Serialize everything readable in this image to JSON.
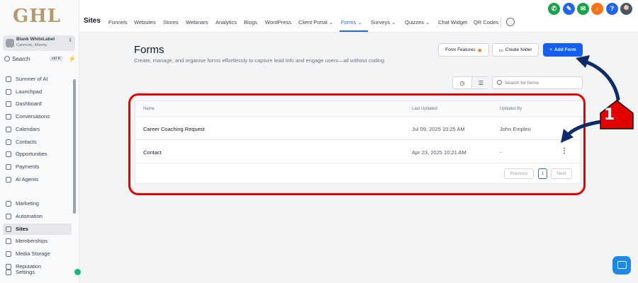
{
  "brand": {
    "logo_text": "GHL"
  },
  "account": {
    "name": "Blank WhiteLabel",
    "location": "Canmore, Alberta"
  },
  "sidebar_search": {
    "label": "Search",
    "shortcut": "ctrl K"
  },
  "sidebar": {
    "items": [
      {
        "label": "Summer of AI",
        "icon": "sparkle-icon"
      },
      {
        "label": "Launchpad",
        "icon": "rocket-icon"
      },
      {
        "label": "Dashboard",
        "icon": "grid-icon"
      },
      {
        "label": "Conversations",
        "icon": "chat-icon"
      },
      {
        "label": "Calendars",
        "icon": "calendar-icon"
      },
      {
        "label": "Contacts",
        "icon": "contacts-icon"
      },
      {
        "label": "Opportunities",
        "icon": "funnel-icon"
      },
      {
        "label": "Payments",
        "icon": "payment-icon"
      },
      {
        "label": "AI Agents",
        "icon": "sparkle-icon"
      },
      {
        "label": "Marketing",
        "icon": "send-icon"
      },
      {
        "label": "Automation",
        "icon": "automation-icon"
      },
      {
        "label": "Sites",
        "icon": "sites-icon",
        "active": true
      },
      {
        "label": "Memberships",
        "icon": "members-icon"
      },
      {
        "label": "Media Storage",
        "icon": "image-icon"
      },
      {
        "label": "Reputation",
        "icon": "star-icon"
      },
      {
        "label": "Settings",
        "icon": "gear-icon"
      }
    ]
  },
  "header": {
    "title": "Sites",
    "tabs": [
      {
        "label": "Funnels"
      },
      {
        "label": "Websites"
      },
      {
        "label": "Stores"
      },
      {
        "label": "Webinars"
      },
      {
        "label": "Analytics"
      },
      {
        "label": "Blogs"
      },
      {
        "label": "WordPress"
      },
      {
        "label": "Client Portal ⌄"
      },
      {
        "label": "Forms ⌄",
        "active": true
      },
      {
        "label": "Surveys ⌄"
      },
      {
        "label": "Quizzes ⌄"
      },
      {
        "label": "Chat Widget"
      },
      {
        "label": "QR Codes"
      }
    ],
    "action_icons": [
      {
        "name": "phone-icon",
        "color": "#16a34a"
      },
      {
        "name": "magic-icon",
        "color": "#2563eb"
      },
      {
        "name": "megaphone-icon",
        "color": "#16a34a"
      },
      {
        "name": "bell-icon",
        "color": "#f97316"
      },
      {
        "name": "help-icon",
        "color": "#2563eb",
        "glyph": "?"
      }
    ]
  },
  "page": {
    "title": "Forms",
    "subtitle": "Create, manage, and organise forms effortlessly to capture lead info and engage users—all without coding",
    "buttons": {
      "form_features": "Form Features",
      "create_folder": "Create folder",
      "add_form": "Add Form"
    },
    "search_placeholder": "Search for forms"
  },
  "table": {
    "peek_label": "Name",
    "columns": [
      "Name",
      "Last Updated",
      "Updated By"
    ],
    "rows": [
      {
        "name": "Career Coaching Request",
        "last_updated": "Jul 09, 2025 10:25 AM",
        "updated_by": "John Empleo"
      },
      {
        "name": "Contact",
        "last_updated": "Apr 23, 2025 10:21 AM",
        "updated_by": "-"
      }
    ],
    "pagination": {
      "previous": "Previous",
      "current_page": "1",
      "next": "Next"
    }
  },
  "annotation": {
    "step_number": "1"
  },
  "colors": {
    "accent": "#155eef",
    "highlight": "#e30000",
    "arrow": "#0d2a6b"
  }
}
